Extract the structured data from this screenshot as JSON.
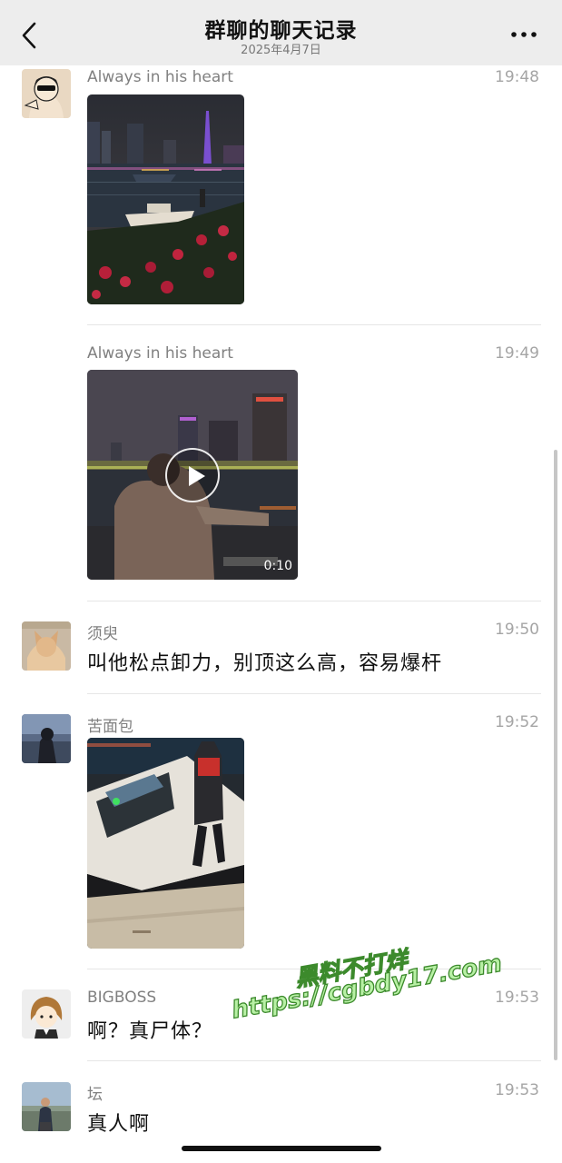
{
  "header": {
    "title": "群聊的聊天记录",
    "date": "2025年4月7日"
  },
  "messages": [
    {
      "sender": "Always in his heart",
      "time": "19:48",
      "type": "image"
    },
    {
      "sender": "Always in his heart",
      "time": "19:49",
      "type": "video",
      "duration": "0:10"
    },
    {
      "sender": "须臾",
      "time": "19:50",
      "type": "text",
      "text": "叫他松点卸力，别顶这么高，容易爆杆"
    },
    {
      "sender": "苦面包",
      "time": "19:52",
      "type": "image"
    },
    {
      "sender": "BIGBOSS",
      "time": "19:53",
      "type": "text",
      "text": "啊？真尸体？"
    },
    {
      "sender": "坛",
      "time": "19:53",
      "type": "text",
      "text": "真人啊"
    }
  ],
  "watermark": {
    "line1": "黑料不打烊",
    "line2": "https://cgbdy17.com"
  },
  "icons": {
    "back": "chevron-left-icon",
    "more": "more-horizontal-icon",
    "play": "play-icon"
  }
}
